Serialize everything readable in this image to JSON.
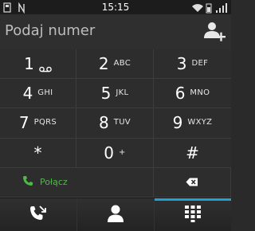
{
  "status_bar": {
    "time": "15:15",
    "left_icons": [
      "notification-icon",
      "nfc-icon"
    ],
    "right_icons": [
      "wifi-icon",
      "signal-icon"
    ]
  },
  "number_input": {
    "placeholder": "Podaj numer",
    "action_icon": "add-contact-icon"
  },
  "keypad": {
    "keys": [
      {
        "digit": "1",
        "letters": "",
        "extra_icon": "voicemail-icon"
      },
      {
        "digit": "2",
        "letters": "ABC"
      },
      {
        "digit": "3",
        "letters": "DEF"
      },
      {
        "digit": "4",
        "letters": "GHI"
      },
      {
        "digit": "5",
        "letters": "JKL"
      },
      {
        "digit": "6",
        "letters": "MNO"
      },
      {
        "digit": "7",
        "letters": "PQRS"
      },
      {
        "digit": "8",
        "letters": "TUV"
      },
      {
        "digit": "9",
        "letters": "WXYZ"
      },
      {
        "digit": "*",
        "letters": ""
      },
      {
        "digit": "0",
        "letters": "+"
      },
      {
        "digit": "#",
        "letters": ""
      }
    ],
    "call_label": "Połącz",
    "call_color": "#4fb848",
    "backspace_icon": "backspace-icon"
  },
  "tabs": [
    {
      "icon": "call-log-icon",
      "active": false
    },
    {
      "icon": "contacts-icon",
      "active": false
    },
    {
      "icon": "dialpad-icon",
      "active": true
    }
  ],
  "colors": {
    "accent": "#1fa3d6",
    "call_green": "#4fb848",
    "background": "#2b2b2b"
  }
}
